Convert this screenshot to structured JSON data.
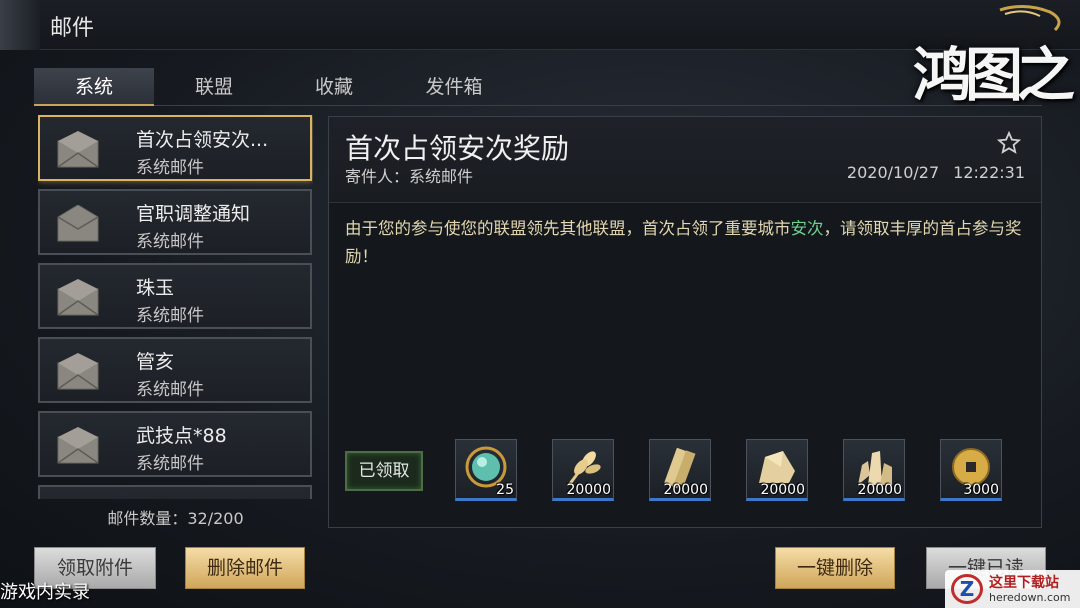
{
  "window": {
    "title": "邮件"
  },
  "game_logo": {
    "text": "鸿图之下"
  },
  "tabs": [
    {
      "label": "系统",
      "active": true
    },
    {
      "label": "联盟",
      "active": false
    },
    {
      "label": "收藏",
      "active": false
    },
    {
      "label": "发件箱",
      "active": false
    }
  ],
  "mail_list": [
    {
      "title": "首次占领安次...",
      "sender": "系统邮件",
      "selected": true,
      "opened": false
    },
    {
      "title": "官职调整通知",
      "sender": "系统邮件",
      "selected": false,
      "opened": true
    },
    {
      "title": "珠玉",
      "sender": "系统邮件",
      "selected": false,
      "opened": false
    },
    {
      "title": "管亥",
      "sender": "系统邮件",
      "selected": false,
      "opened": false
    },
    {
      "title": "武技点*88",
      "sender": "系统邮件",
      "selected": false,
      "opened": false
    }
  ],
  "mail_count": {
    "label": "邮件数量：",
    "value": "32/200"
  },
  "mail_detail": {
    "title": "首次占领安次奖励",
    "sender_label": "寄件人：",
    "sender": "系统邮件",
    "date": "2020/10/27",
    "time": "12:22:31",
    "body_before": "由于您的参与使您的联盟领先其他联盟，首次占领了重要城市",
    "body_city": "安次",
    "body_after": "，请领取丰厚的首占参与奖励！",
    "claimed_label": "已领取",
    "rewards": [
      {
        "icon": "jade-orb-icon",
        "qty": "25"
      },
      {
        "icon": "grain-icon",
        "qty": "20000"
      },
      {
        "icon": "wood-icon",
        "qty": "20000"
      },
      {
        "icon": "stone-icon",
        "qty": "20000"
      },
      {
        "icon": "iron-ore-icon",
        "qty": "20000"
      },
      {
        "icon": "copper-coin-icon",
        "qty": "3000"
      }
    ]
  },
  "buttons": {
    "claim_attachments": "领取附件",
    "delete_mail": "删除邮件",
    "delete_all": "一键删除",
    "read_all": "一键已读"
  },
  "watermark": "游戏内实录",
  "site_logo": {
    "name": "这里下载站",
    "url": "heredown.com"
  },
  "colors": {
    "gold_border": "#d9b464",
    "highlight_city": "#6fcf8e",
    "body_text": "#e2d7b0"
  }
}
